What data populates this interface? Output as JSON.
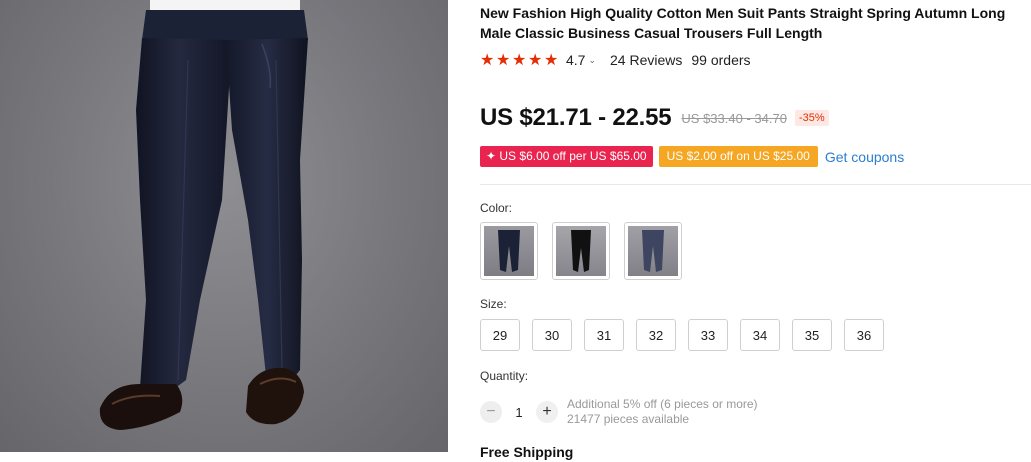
{
  "product": {
    "title": "New Fashion High Quality Cotton Men Suit Pants Straight Spring Autumn Long Male Classic Business Casual Trousers Full Length",
    "rating": "4.7",
    "reviews": "24 Reviews",
    "orders": "99 orders",
    "stars_filled": 5
  },
  "price": {
    "current": "US $21.71 - 22.55",
    "original": "US $33.40 - 34.70",
    "discount": "-35%"
  },
  "coupons": {
    "red": "✦ US $6.00 off per US $65.00",
    "orange": "US $2.00 off on US $25.00",
    "link": "Get coupons"
  },
  "options": {
    "color_label": "Color:",
    "size_label": "Size:",
    "sizes": [
      "29",
      "30",
      "31",
      "32",
      "33",
      "34",
      "35",
      "36"
    ],
    "quantity_label": "Quantity:",
    "quantity": "1",
    "quantity_minus": "−",
    "quantity_plus": "+",
    "bulk_discount": "Additional 5% off (6 pieces or more)",
    "available": "21477 pieces available"
  },
  "shipping": {
    "label": "Free Shipping"
  },
  "colors": {
    "accent_red": "#e62e04",
    "coupon_red": "#e8244f",
    "coupon_orange": "#f5a623",
    "link_blue": "#2c7ed1",
    "pants_navy": "#1c2236"
  }
}
